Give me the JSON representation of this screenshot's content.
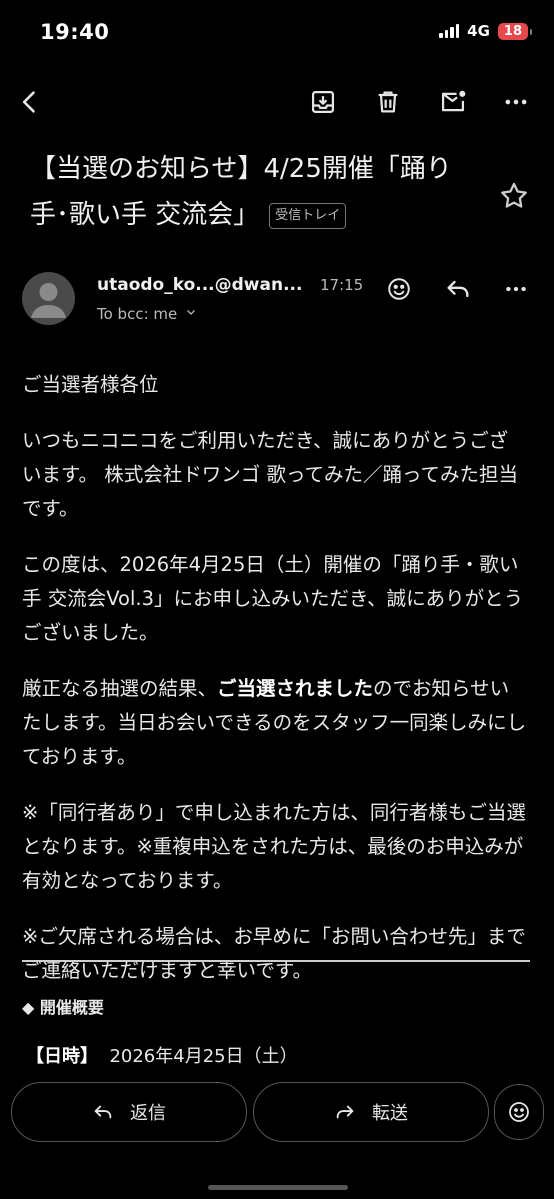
{
  "status_bar": {
    "time": "19:40",
    "network": "4G",
    "battery": "18"
  },
  "toolbar": {
    "back_icon": "chevron-left-icon",
    "archive_icon": "archive-icon",
    "delete_icon": "trash-icon",
    "mark_unread_icon": "mark-unread-icon",
    "more_icon": "more-horizontal-icon"
  },
  "email": {
    "subject": "【当選のお知らせ】4/25開催「踊り手･歌い手 交流会」",
    "label": "受信トレイ",
    "sender": "utaodo_ko...@dwan...",
    "time": "17:15",
    "to_line": "To bcc: me",
    "body": {
      "p1": "ご当選者様各位",
      "p2": "いつもニコニコをご利用いただき、誠にありがとうございます。 株式会社ドワンゴ 歌ってみた／踊ってみた担当です。",
      "p3": "この度は、2026年4月25日（土）開催の「踊り手・歌い手 交流会Vol.3」にお申し込みいただき、誠にありがとうございました。",
      "p4_pre": "厳正なる抽選の結果、",
      "p4_bold": "ご当選されました",
      "p4_post": "のでお知らせいたします。当日お会いできるのをスタッフ一同楽しみにしております。",
      "p5": "※「同行者あり」で申し込まれた方は、同行者様もご当選となります。※重複申込をされた方は、最後のお申込みが有効となっております。",
      "p6": "※ご欠席される場合は、お早めに「お問い合わせ先」までご連絡いただけますと幸いです。"
    },
    "section_heading": "◆ 開催概要",
    "date_label": "【日時】",
    "date_value": "2026年4月25日（土）"
  },
  "actions": {
    "reply": "返信",
    "forward": "転送"
  },
  "colors": {
    "background": "#000000",
    "battery": "#e5484d",
    "text": "#e6e6e6"
  }
}
